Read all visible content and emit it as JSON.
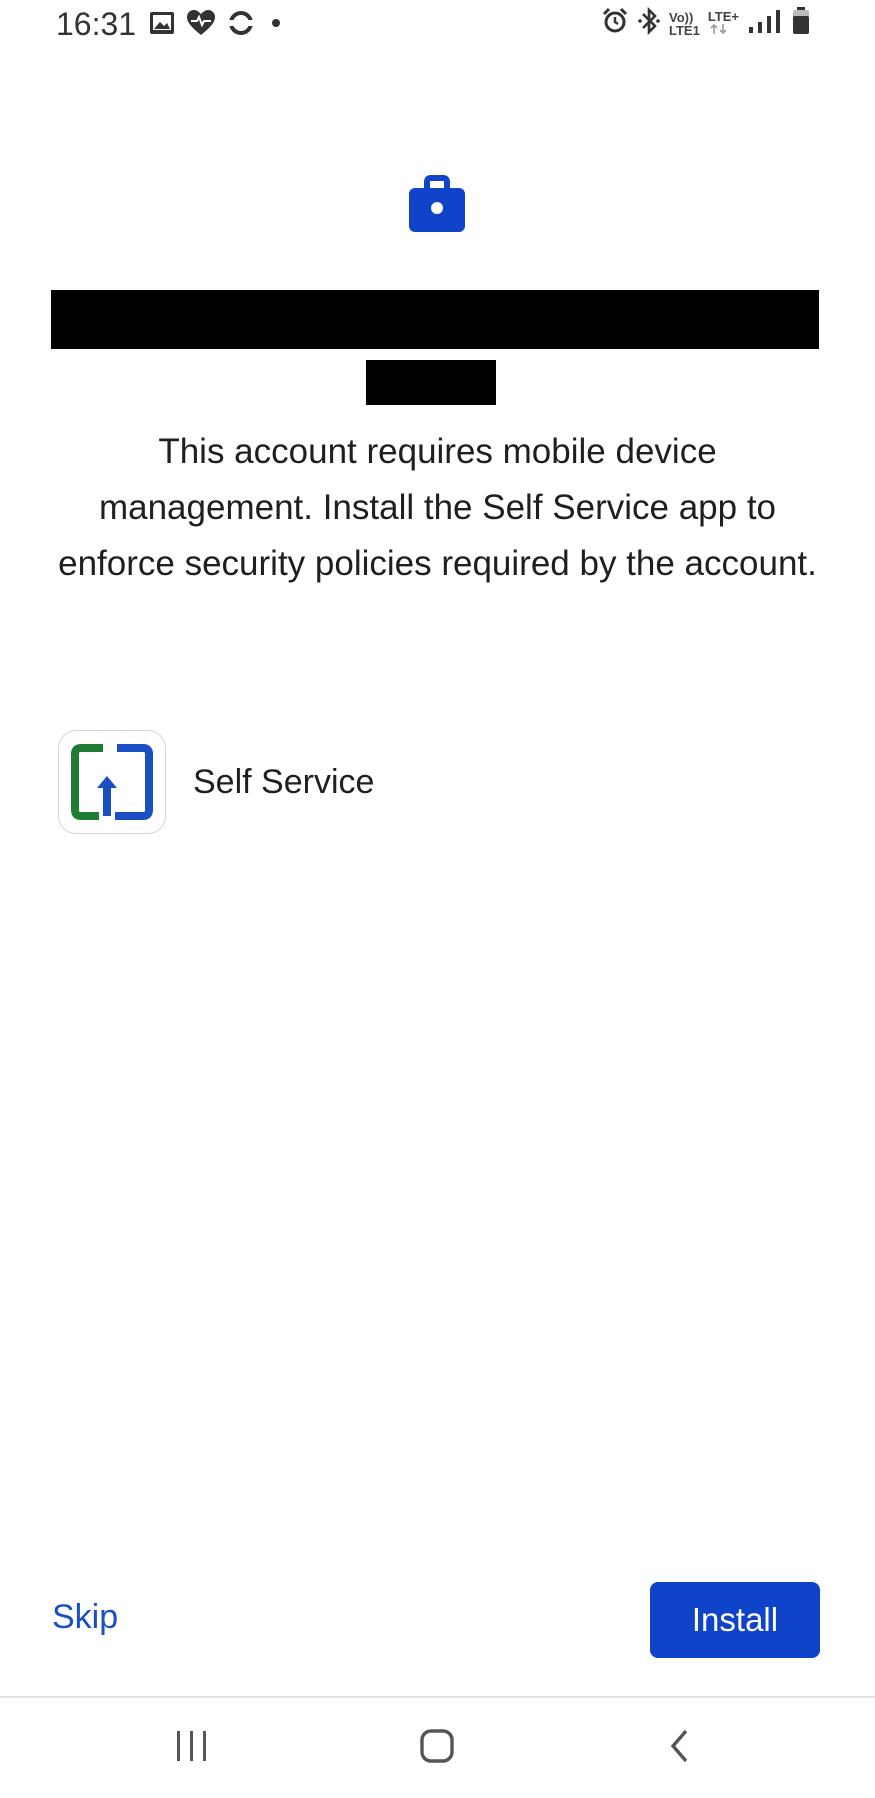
{
  "status_bar": {
    "time": "16:31",
    "left_icons": [
      "image-icon",
      "health-icon",
      "sync-icon",
      "dot-icon"
    ],
    "right_icons": [
      "alarm-icon",
      "bluetooth-icon",
      "volte-icon",
      "lte-icon",
      "signal-icon",
      "battery-icon"
    ],
    "volte_line1": "Vo))",
    "volte_line2": "LTE1",
    "lte_label": "LTE+"
  },
  "header": {
    "icon": "briefcase-lock-icon",
    "accent_color": "#0f43c9"
  },
  "message": "This account requires mobile device management. Install the Self Service app to enforce security policies required by the account.",
  "app": {
    "icon": "self-service-app-icon",
    "name": "Self Service",
    "icon_colors": {
      "green": "#1e7d32",
      "blue": "#1a4fc4"
    }
  },
  "actions": {
    "skip_label": "Skip",
    "install_label": "Install"
  },
  "navigation_bar": {
    "buttons": [
      "recent-apps",
      "home",
      "back"
    ]
  }
}
